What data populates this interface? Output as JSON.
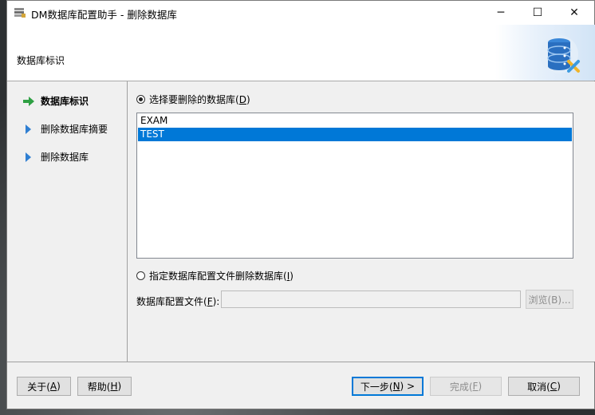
{
  "window": {
    "title": "DM数据库配置助手 - 删除数据库",
    "minimize_glyph": "─",
    "maximize_glyph": "☐",
    "close_glyph": "✕"
  },
  "header": {
    "title": "数据库标识"
  },
  "nav": {
    "items": [
      {
        "label": "数据库标识",
        "active": true,
        "icon": "green-arrow-icon"
      },
      {
        "label": "删除数据库摘要",
        "active": false,
        "icon": "blue-triangle-icon"
      },
      {
        "label": "删除数据库",
        "active": false,
        "icon": "blue-triangle-icon"
      }
    ]
  },
  "main": {
    "option_select": {
      "text": "选择要删除的数据库(",
      "mnemonic": "D",
      "close": ")",
      "checked": true
    },
    "databases": [
      "EXAM",
      "TEST"
    ],
    "selected_database": "TEST",
    "option_config": {
      "text": "指定数据库配置文件删除数据库(",
      "mnemonic": "I",
      "close": ")",
      "checked": false
    },
    "config_file": {
      "label_text": "数据库配置文件(",
      "mnemonic": "F",
      "label_close": "):",
      "value": ""
    },
    "browse": {
      "label": "浏览(B)..."
    }
  },
  "footer": {
    "about": {
      "text": "关于(",
      "mnemonic": "A",
      "close": ")"
    },
    "help": {
      "text": "帮助(",
      "mnemonic": "H",
      "close": ")"
    },
    "next": {
      "text": "下一步(",
      "mnemonic": "N",
      "close": ") >"
    },
    "finish": {
      "text": "完成(",
      "mnemonic": "F",
      "close": ")"
    },
    "cancel": {
      "text": "取消(",
      "mnemonic": "C",
      "close": ")"
    }
  },
  "colors": {
    "selection": "#0078d7",
    "nav_arrow_active": "#2ea043",
    "nav_arrow": "#2f7fd2"
  }
}
